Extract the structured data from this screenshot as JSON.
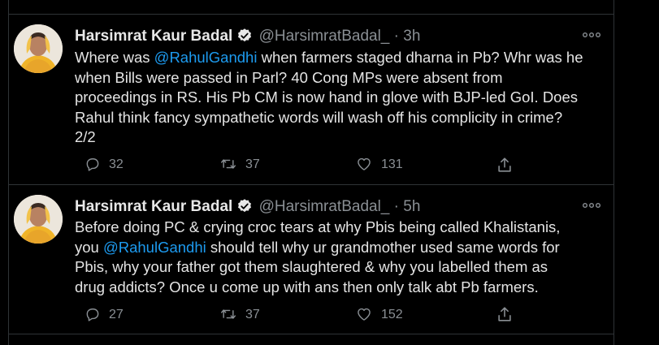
{
  "tweets": [
    {
      "author_name": "Harsimrat Kaur Badal",
      "handle": "@HarsimratBadal_",
      "separator": "·",
      "time": "3h",
      "text_lines": [
        {
          "pre": "Where was ",
          "mention": "@RahulGandhi",
          "post": " when farmers staged dharna in Pb? Whr was he"
        },
        {
          "pre": "when Bills were passed in Parl? 40 Cong MPs were absent from",
          "mention": "",
          "post": ""
        },
        {
          "pre": "proceedings in RS. His Pb CM is now hand in glove with BJP-led GoI. Does",
          "mention": "",
          "post": ""
        },
        {
          "pre": "Rahul think fancy sympathetic words will wash off his complicity in crime?",
          "mention": "",
          "post": ""
        },
        {
          "pre": "2/2",
          "mention": "",
          "post": ""
        }
      ],
      "replies": "32",
      "retweets": "37",
      "likes": "131"
    },
    {
      "author_name": "Harsimrat Kaur Badal",
      "handle": "@HarsimratBadal_",
      "separator": "·",
      "time": "5h",
      "text_lines": [
        {
          "pre": "Before doing PC & crying croc tears at why Pbis being called Khalistanis,",
          "mention": "",
          "post": ""
        },
        {
          "pre": "you ",
          "mention": "@RahulGandhi",
          "post": " should tell why ur grandmother used same words for"
        },
        {
          "pre": "Pbis, why your father got them slaughtered & why you labelled them as",
          "mention": "",
          "post": ""
        },
        {
          "pre": "drug addicts? Once u come up with ans then only talk abt Pb farmers.",
          "mention": "",
          "post": ""
        }
      ],
      "replies": "27",
      "retweets": "37",
      "likes": "152"
    }
  ],
  "colors": {
    "background": "#000000",
    "mention": "#1d9bf0",
    "secondary_text": "#8a8f94",
    "verified_badge": "#e8e8e8",
    "divider": "#2f3336"
  },
  "icons": [
    "verified-badge-icon",
    "more-options-icon",
    "reply-icon",
    "retweet-icon",
    "like-icon",
    "share-icon"
  ]
}
